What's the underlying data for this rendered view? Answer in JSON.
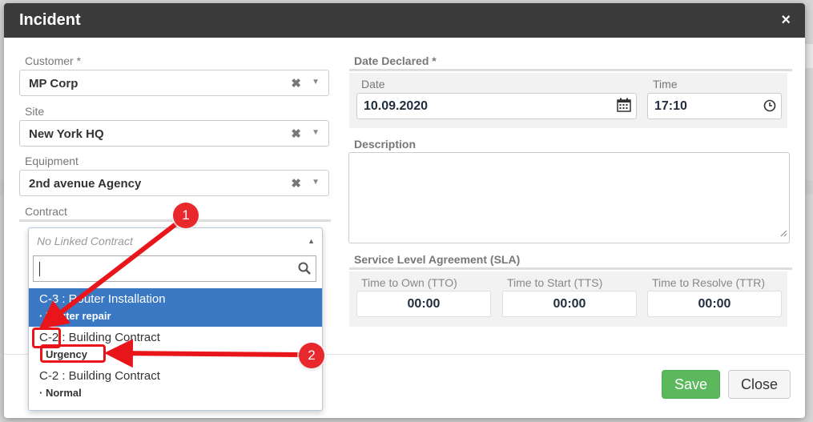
{
  "modal": {
    "title": "Incident",
    "close_symbol": "×"
  },
  "customer": {
    "label": "Customer *",
    "value": "MP Corp"
  },
  "site": {
    "label": "Site",
    "value": "New York HQ"
  },
  "equipment": {
    "label": "Equipment",
    "value": "2nd avenue Agency"
  },
  "contract": {
    "label": "Contract",
    "placeholder": "No Linked Contract",
    "options": [
      {
        "line1": "C-3 : Router Installation",
        "line2": "· Router repair"
      },
      {
        "line1": "C-2 : Building Contract",
        "line2": "· Urgency"
      },
      {
        "line1": "C-2 : Building Contract",
        "line2": "· Normal"
      }
    ]
  },
  "date_declared": {
    "label": "Date Declared *",
    "date_label": "Date",
    "date_value": "10.09.2020",
    "time_label": "Time",
    "time_value": "17:10"
  },
  "description": {
    "label": "Description"
  },
  "sla": {
    "label": "Service Level Agreement (SLA)",
    "tto_label": "Time to Own (TTO)",
    "tto_value": "00:00",
    "tts_label": "Time to Start (TTS)",
    "tts_value": "00:00",
    "ttr_label": "Time to Resolve (TTR)",
    "ttr_value": "00:00"
  },
  "buttons": {
    "save": "Save",
    "close": "Close"
  },
  "annotations": {
    "badge_1": "1",
    "badge_2": "2"
  },
  "colors": {
    "header": "#3a3a3a",
    "highlight": "#3b78c3",
    "save": "#5cb85c",
    "annotation": "#e8161b"
  },
  "icons": [
    "close-icon",
    "clear-icon",
    "chevron-down-icon",
    "calendar-icon",
    "clock-icon",
    "search-icon",
    "chevron-up-icon",
    "resize-grip-icon"
  ]
}
